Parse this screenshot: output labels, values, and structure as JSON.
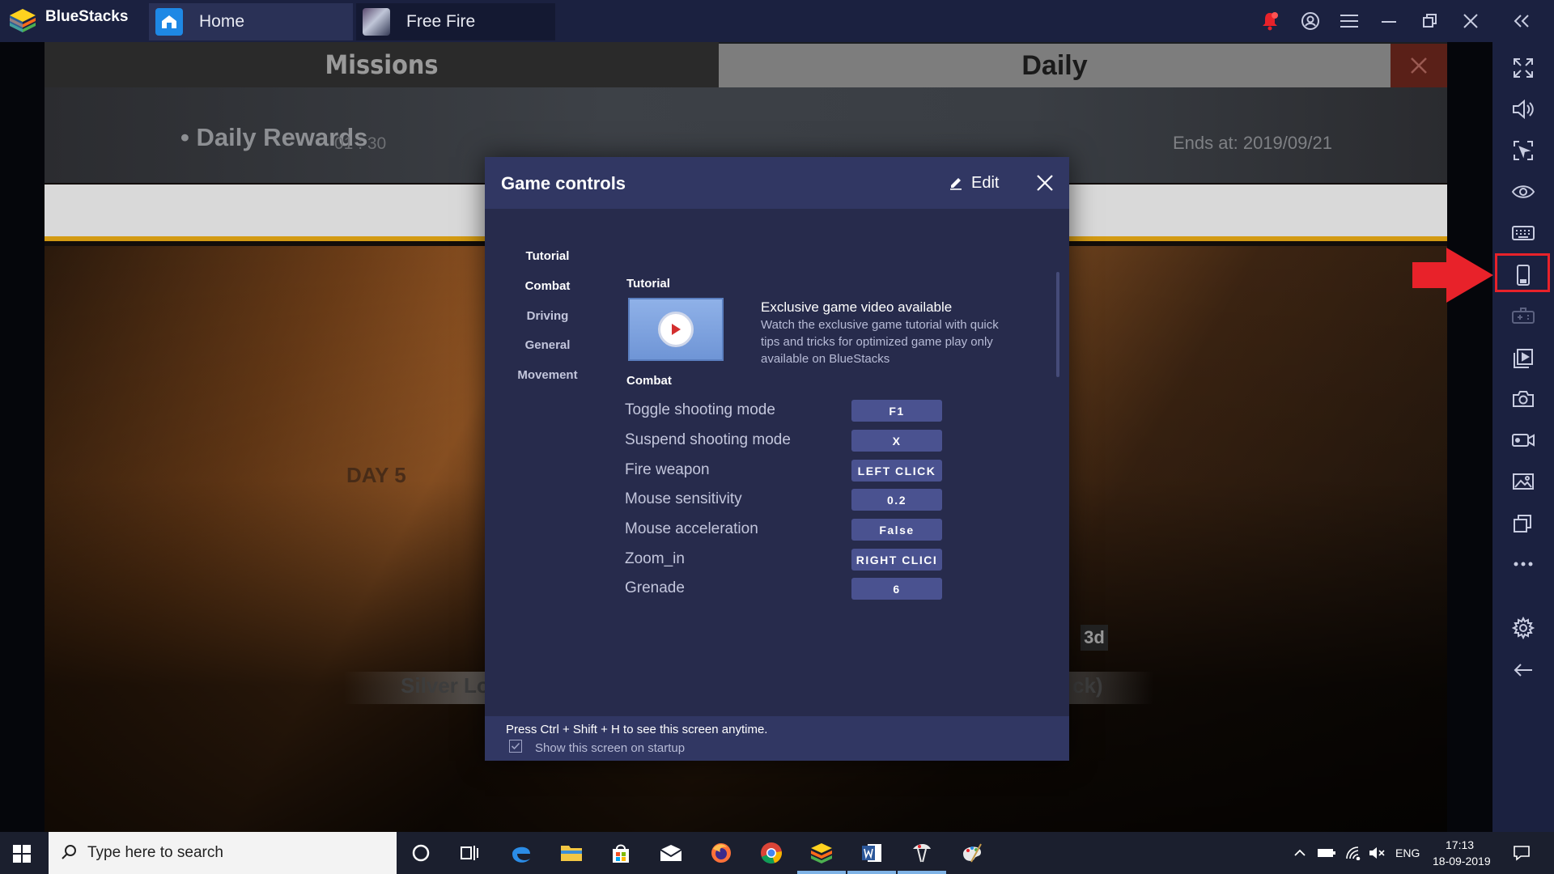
{
  "app": {
    "name": "BlueStacks",
    "tabs": [
      {
        "label": "Home"
      },
      {
        "label": "Free Fire"
      }
    ]
  },
  "game": {
    "tab_missions": "Missions",
    "tab_daily": "Daily",
    "rewards_title": "Daily Rewards",
    "rewards_timer": "01 : 30",
    "ends_at": "Ends at: 2019/09/21",
    "loot_left": "Silver Loot",
    "loot_right": "ck)",
    "badge": "3d"
  },
  "modal": {
    "title": "Game controls",
    "edit_label": "Edit",
    "nav": [
      "Tutorial",
      "Combat",
      "Driving",
      "General",
      "Movement"
    ],
    "tutorial_section": "Tutorial",
    "video_title": "Exclusive game video available",
    "video_desc": "Watch the exclusive game tutorial with quick tips and tricks for optimized game play only available on BlueStacks",
    "combat_section": "Combat",
    "controls": [
      {
        "label": "Toggle shooting mode",
        "key": "F1"
      },
      {
        "label": "Suspend shooting mode",
        "key": "X"
      },
      {
        "label": "Fire weapon",
        "key": "LEFT CLICK"
      },
      {
        "label": "Mouse sensitivity",
        "key": "0.2"
      },
      {
        "label": "Mouse acceleration",
        "key": "False"
      },
      {
        "label": "Zoom_in",
        "key": "RIGHT CLICI"
      },
      {
        "label": "Grenade",
        "key": "6"
      }
    ],
    "footer_hint": "Press Ctrl + Shift + H to see this screen anytime.",
    "show_on_startup_label": "Show this screen on startup",
    "show_on_startup_checked": true
  },
  "taskbar": {
    "search_placeholder": "Type here to search",
    "language": "ENG",
    "time": "17:13",
    "date": "18-09-2019"
  },
  "colors": {
    "titlebar": "#1b2140",
    "modal_bg": "#272b4c",
    "modal_header": "#313763",
    "key_button": "#4a5290",
    "highlight_red": "#e8222a",
    "game_accent_gold": "#d39a13"
  }
}
